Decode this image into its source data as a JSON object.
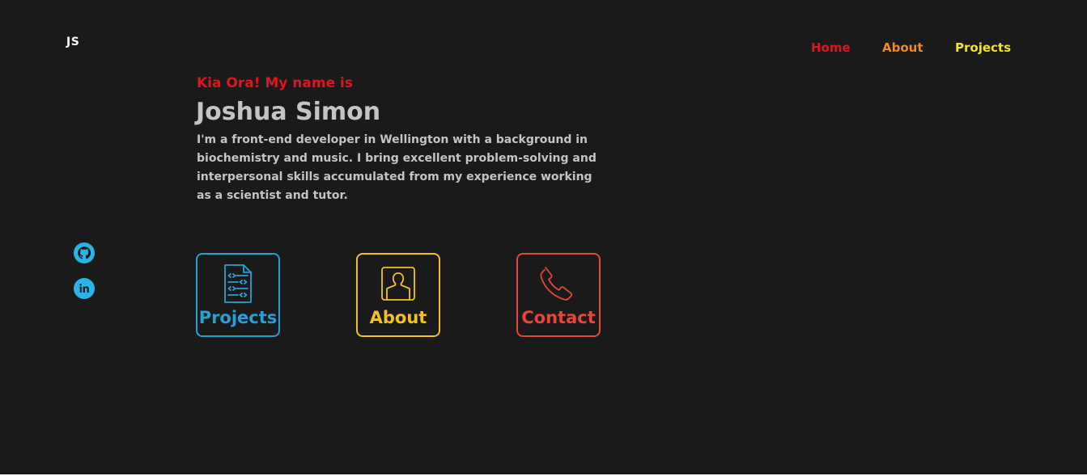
{
  "logo": "JS",
  "nav": {
    "items": [
      {
        "label": "Home",
        "color": "#e0141e"
      },
      {
        "label": "About",
        "color": "#f08a1c"
      },
      {
        "label": "Projects",
        "color": "#f0e41a"
      }
    ]
  },
  "hero": {
    "greeting": "Kia Ora! My name is",
    "greeting_color": "#e0141e",
    "name": "Joshua Simon",
    "name_color": "#c4c4c4",
    "bio": "I'm a front-end developer in Wellington with a background in biochemistry and music. I bring excellent problem-solving and interpersonal skills accumulated from my experience working as a scientist and tutor.",
    "bio_color": "#c4c4c4"
  },
  "socials": [
    {
      "icon": "github-icon",
      "color": "#29b6e6"
    },
    {
      "icon": "linkedin-icon",
      "color": "#29b6e6"
    }
  ],
  "cards": [
    {
      "label": "Projects",
      "icon": "code-document-icon",
      "color": "#2a9fd6"
    },
    {
      "label": "About",
      "icon": "user-profile-icon",
      "color": "#f5c024"
    },
    {
      "label": "Contact",
      "icon": "phone-icon",
      "color": "#e4463a"
    }
  ],
  "background": "#1a1a1a"
}
